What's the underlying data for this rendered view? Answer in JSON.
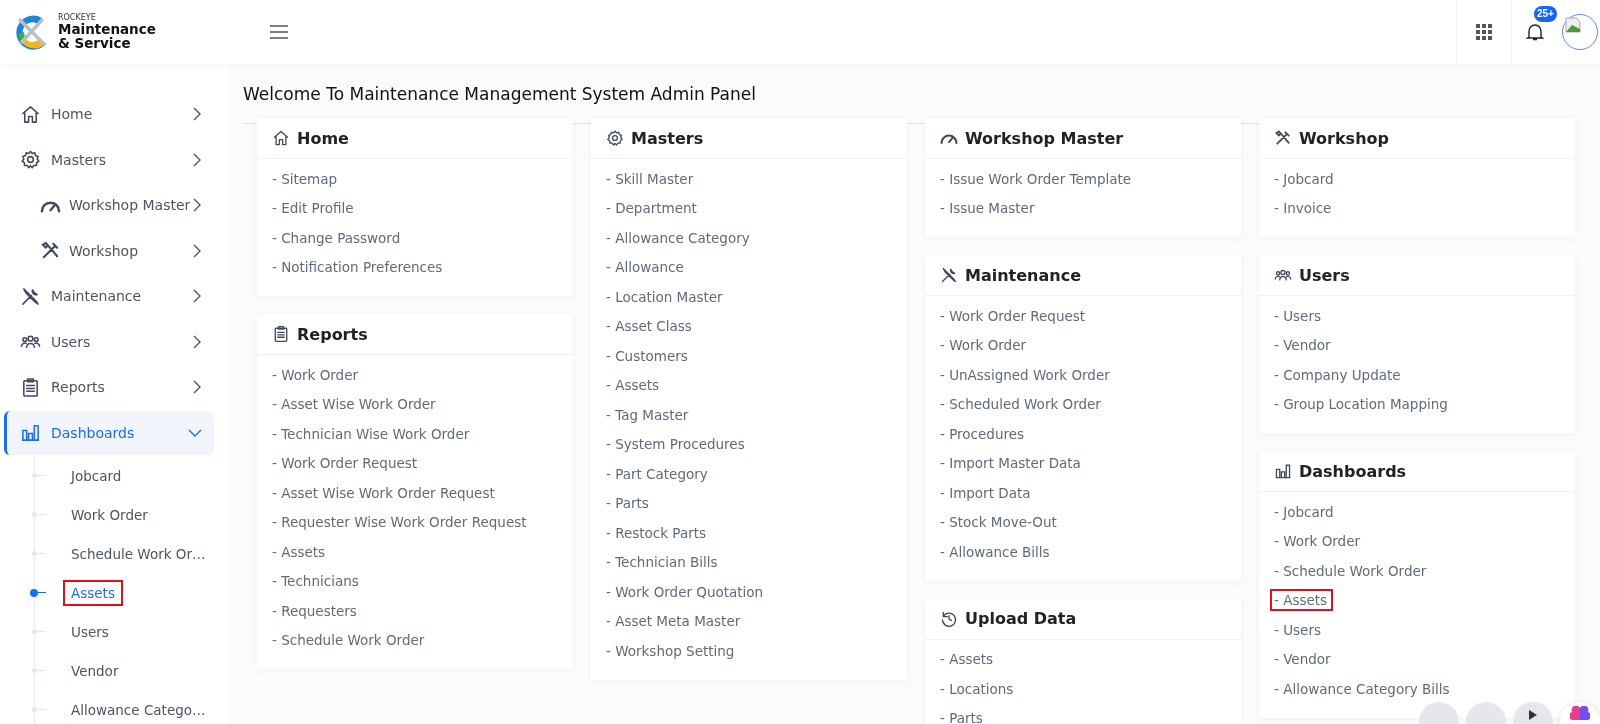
{
  "header": {
    "brand_small": "ROCKEYE",
    "brand_line1": "Maintenance",
    "brand_line2": "& Service",
    "notification_badge": "25+"
  },
  "sidebar": {
    "items": [
      {
        "label": "Home",
        "expanded": false,
        "selected": false
      },
      {
        "label": "Masters",
        "expanded": false,
        "selected": false
      },
      {
        "label": "Workshop Master",
        "expanded": false,
        "selected": false
      },
      {
        "label": "Workshop",
        "expanded": false,
        "selected": false
      },
      {
        "label": "Maintenance",
        "expanded": false,
        "selected": false
      },
      {
        "label": "Users",
        "expanded": false,
        "selected": false
      },
      {
        "label": "Reports",
        "expanded": false,
        "selected": false
      },
      {
        "label": "Dashboards",
        "expanded": true,
        "selected": true,
        "children": [
          {
            "label": "Jobcard",
            "selected": false,
            "highlighted": false
          },
          {
            "label": "Work Order",
            "selected": false,
            "highlighted": false
          },
          {
            "label": "Schedule Work Or…",
            "selected": false,
            "highlighted": false
          },
          {
            "label": "Assets",
            "selected": true,
            "highlighted": true
          },
          {
            "label": "Users",
            "selected": false,
            "highlighted": false
          },
          {
            "label": "Vendor",
            "selected": false,
            "highlighted": false
          },
          {
            "label": "Allowance Catego…",
            "selected": false,
            "highlighted": false
          }
        ]
      }
    ]
  },
  "main": {
    "title": "Welcome To Maintenance Management System Admin Panel",
    "columns": [
      {
        "cards": [
          {
            "title": "Home",
            "items": [
              "- Sitemap",
              "- Edit Profile",
              "- Change Password",
              "- Notification Preferences"
            ]
          },
          {
            "title": "Reports",
            "items": [
              "- Work Order",
              "- Asset Wise Work Order",
              "- Technician Wise Work Order",
              "- Work Order Request",
              "- Asset Wise Work Order Request",
              "- Requester Wise Work Order Request",
              "- Assets",
              "- Technicians",
              "- Requesters",
              "- Schedule Work Order"
            ]
          }
        ]
      },
      {
        "cards": [
          {
            "title": "Masters",
            "items": [
              "- Skill Master",
              "- Department",
              "- Allowance Category",
              "- Allowance",
              "- Location Master",
              "- Asset Class",
              "- Customers",
              "- Assets",
              "- Tag Master",
              "- System Procedures",
              "- Part Category",
              "- Parts",
              "- Restock Parts",
              "- Technician Bills",
              "- Work Order Quotation",
              "- Asset Meta Master",
              "- Workshop Setting"
            ]
          }
        ]
      },
      {
        "cards": [
          {
            "title": "Workshop Master",
            "items": [
              "- Issue Work Order Template",
              "- Issue Master"
            ]
          },
          {
            "title": "Maintenance",
            "items": [
              "- Work Order Request",
              "- Work Order",
              "- UnAssigned Work Order",
              "- Scheduled Work Order",
              "- Procedures",
              "- Import Master Data",
              "- Import Data",
              "- Stock Move-Out",
              "- Allowance Bills"
            ]
          },
          {
            "title": "Upload Data",
            "items": [
              "- Assets",
              "- Locations",
              "- Parts"
            ]
          }
        ]
      },
      {
        "cards": [
          {
            "title": "Workshop",
            "items": [
              "- Jobcard",
              "- Invoice"
            ]
          },
          {
            "title": "Users",
            "items": [
              "- Users",
              "- Vendor",
              "- Company Update",
              "- Group Location Mapping"
            ]
          },
          {
            "title": "Dashboards",
            "items": [
              {
                "text": "- Jobcard",
                "highlighted": false
              },
              {
                "text": "- Work Order",
                "highlighted": false
              },
              {
                "text": "- Schedule Work Order",
                "highlighted": false
              },
              {
                "text": "- Assets",
                "highlighted": true
              },
              {
                "text": "- Users",
                "highlighted": false
              },
              {
                "text": "- Vendor",
                "highlighted": false
              },
              {
                "text": "- Allowance Category Bills",
                "highlighted": false
              }
            ]
          }
        ]
      }
    ]
  }
}
